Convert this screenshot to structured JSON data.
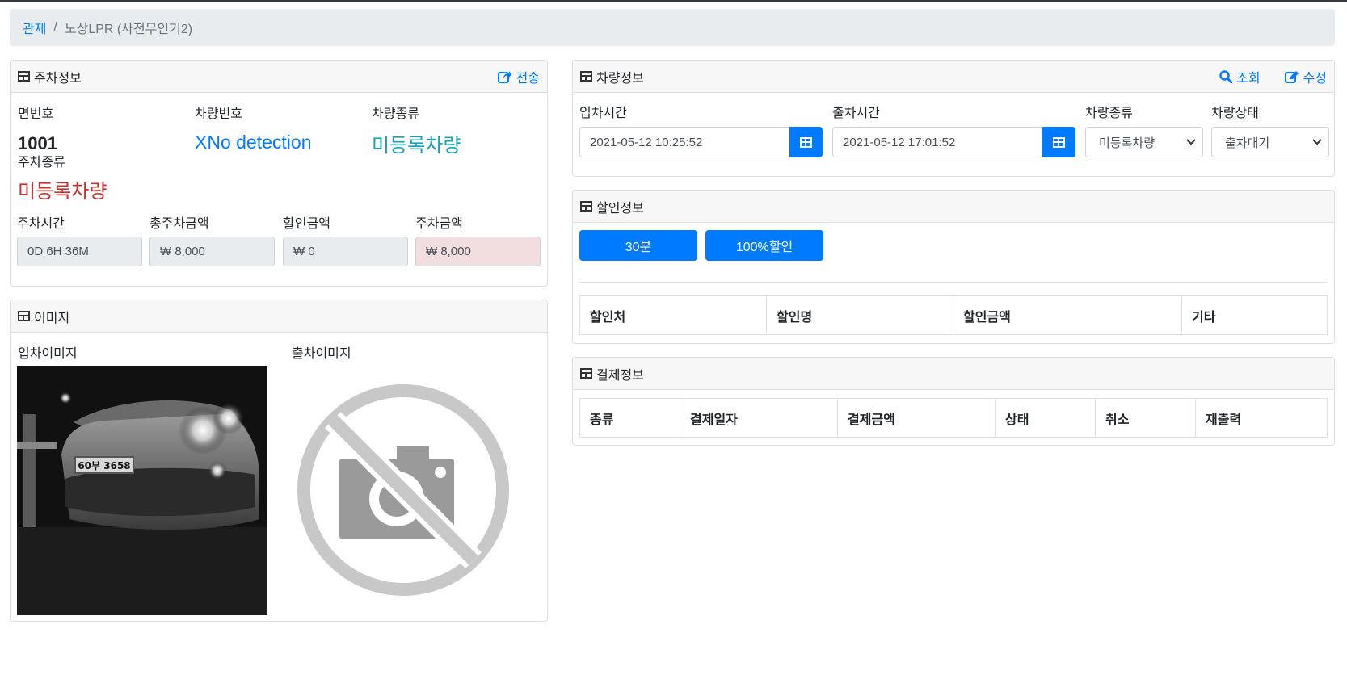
{
  "breadcrumb": {
    "root": "관제",
    "separator": "/",
    "current": "노상LPR (사전무인기2)"
  },
  "parking": {
    "title": "주차정보",
    "send_label": "전송",
    "space_label": "면번호",
    "space_value": "1001",
    "plate_label": "차량번호",
    "plate_value": "XNo detection",
    "vehicle_type_label": "차량종류",
    "vehicle_type_value": "미등록차량",
    "parking_type_label": "주차종류",
    "parking_type_value": "미등록차량",
    "duration_label": "주차시간",
    "duration_value": "0D 6H 36M",
    "total_label": "총주차금액",
    "total_value": "₩ 8,000",
    "discount_label": "할인금액",
    "discount_value": "₩ 0",
    "fee_label": "주차금액",
    "fee_value": "₩ 8,000"
  },
  "images": {
    "title": "이미지",
    "entry_label": "입차이미지",
    "entry_plate_text": "60부 3658",
    "exit_label": "출차이미지"
  },
  "vehicle": {
    "title": "차량정보",
    "search_label": "조회",
    "edit_label": "수정",
    "entry_time_label": "입차시간",
    "entry_time_value": "2021-05-12 10:25:52",
    "exit_time_label": "출차시간",
    "exit_time_value": "2021-05-12 17:01:52",
    "type_label": "차량종류",
    "type_value": "미등록차량",
    "status_label": "차량상태",
    "status_value": "출차대기"
  },
  "discount": {
    "title": "할인정보",
    "buttons": [
      "30분",
      "100%할인"
    ],
    "columns": [
      "할인처",
      "할인명",
      "할인금액",
      "기타"
    ]
  },
  "payment": {
    "title": "결제정보",
    "columns": [
      "종류",
      "결제일자",
      "결제금액",
      "상태",
      "취소",
      "재출력"
    ]
  },
  "colors": {
    "primary": "#007bff",
    "danger": "#c9302c",
    "info": "#17a2b8",
    "header_bg": "#f7f7f7"
  }
}
